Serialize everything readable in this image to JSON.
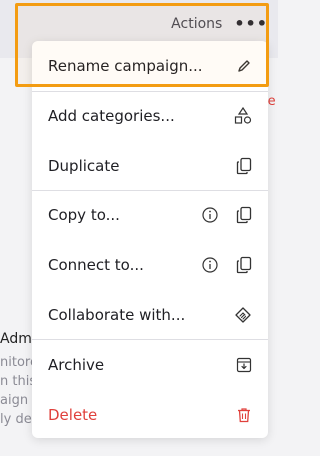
{
  "header": {
    "actions_label": "Actions",
    "more_label": "•••"
  },
  "background": {
    "red_fragment": "le",
    "admin_fragment": "Admi",
    "lines": [
      "nitore",
      "n this",
      "aign c",
      "ly dea"
    ]
  },
  "menu": {
    "items": [
      {
        "label": "Rename campaign...",
        "icon": "pencil-icon"
      },
      {
        "label": "Add categories...",
        "icon": "shapes-icon"
      },
      {
        "label": "Duplicate",
        "icon": "copy-icon"
      },
      {
        "label": "Copy to...",
        "icon": "copy-icon",
        "info_icon": "info-icon"
      },
      {
        "label": "Connect to...",
        "icon": "copy-icon",
        "info_icon": "info-icon"
      },
      {
        "label": "Collaborate with...",
        "icon": "handshake-icon"
      },
      {
        "label": "Archive",
        "icon": "archive-icon"
      },
      {
        "label": "Delete",
        "icon": "trash-icon",
        "danger": true
      }
    ]
  },
  "colors": {
    "highlight": "#f39c12",
    "danger": "#e0413c"
  }
}
